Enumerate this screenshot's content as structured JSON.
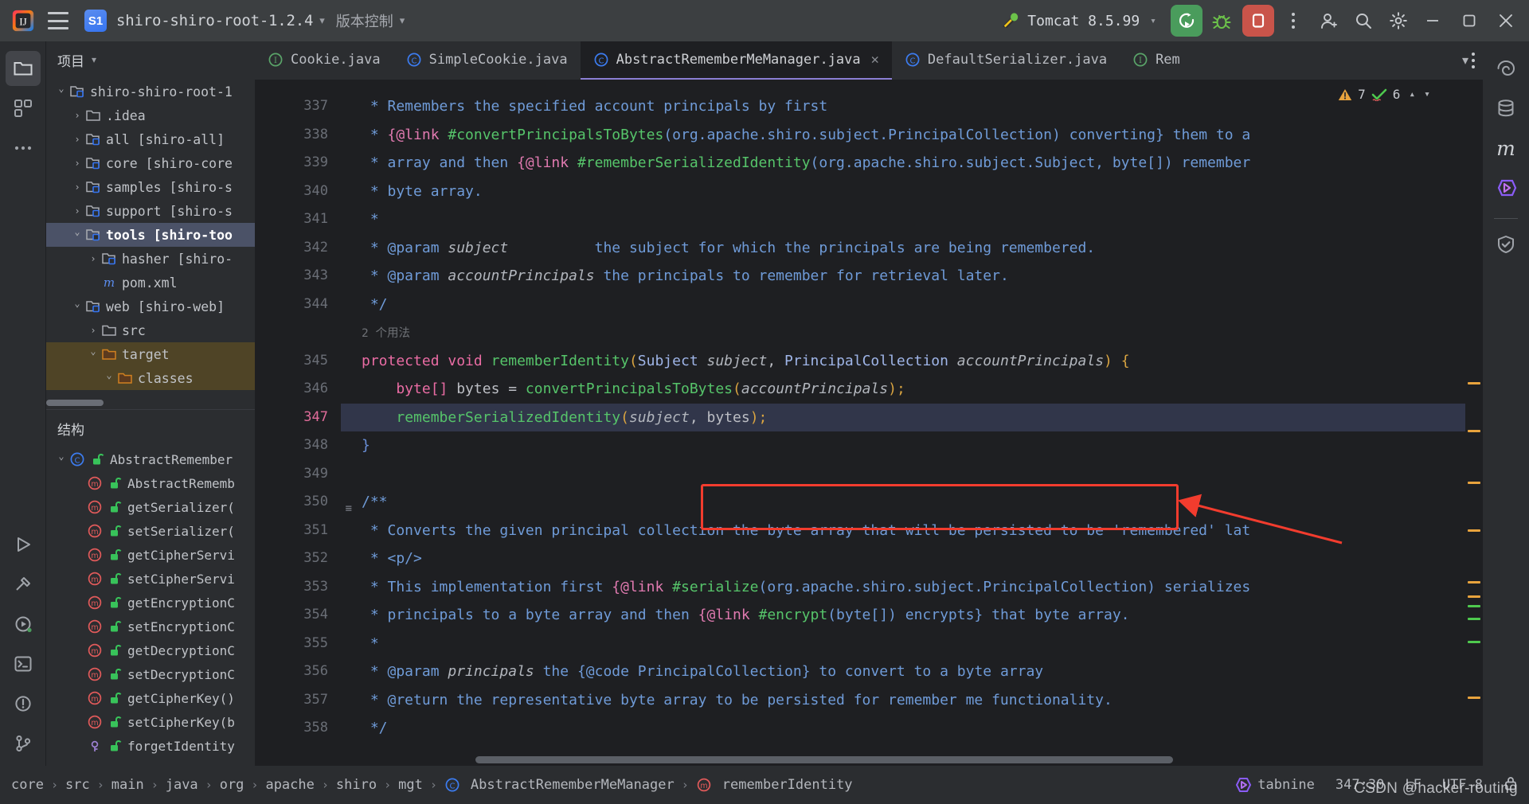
{
  "titlebar": {
    "menu_icon": "hamburger-menu-icon",
    "project_badge": "S1",
    "project_name": "shiro-shiro-root-1.2.4",
    "vcs_label": "版本控制",
    "run_config": "Tomcat 8.5.99",
    "run_button": "run-icon",
    "debug_button": "debug-icon",
    "stop_button": "stop-icon",
    "more_button": "more-vertical-icon",
    "account_button": "account-icon",
    "search_button": "search-icon",
    "settings_button": "settings-icon",
    "minimize": "minimize-icon",
    "maximize": "maximize-icon",
    "close": "close-icon"
  },
  "left_rail": {
    "items": [
      {
        "name": "project-tool-icon",
        "active": true
      },
      {
        "name": "commit-tool-icon",
        "active": false
      },
      {
        "name": "more-tools-icon",
        "active": false
      }
    ],
    "bottom_items": [
      {
        "name": "run-tool-icon"
      },
      {
        "name": "build-tool-icon"
      },
      {
        "name": "services-tool-icon"
      },
      {
        "name": "terminal-tool-icon"
      },
      {
        "name": "problems-tool-icon"
      },
      {
        "name": "version-control-tool-icon"
      }
    ]
  },
  "right_rail": {
    "items": [
      {
        "name": "notifications-icon"
      },
      {
        "name": "database-icon"
      },
      {
        "name": "maven-icon"
      },
      {
        "name": "tabnine-icon"
      },
      {
        "name": "security-icon"
      }
    ]
  },
  "project_panel": {
    "title": "项目",
    "tree": [
      {
        "depth": 0,
        "arrow": "open",
        "icon": "module-folder",
        "label": "shiro-shiro-root-1",
        "selected": false
      },
      {
        "depth": 1,
        "arrow": "closed",
        "icon": "folder",
        "label": ".idea",
        "selected": false
      },
      {
        "depth": 1,
        "arrow": "closed",
        "icon": "module-folder",
        "label": "all [shiro-all]",
        "selected": false
      },
      {
        "depth": 1,
        "arrow": "closed",
        "icon": "module-folder",
        "label": "core [shiro-core",
        "selected": false
      },
      {
        "depth": 1,
        "arrow": "closed",
        "icon": "module-folder",
        "label": "samples [shiro-s",
        "selected": false
      },
      {
        "depth": 1,
        "arrow": "closed",
        "icon": "module-folder",
        "label": "support [shiro-s",
        "selected": false
      },
      {
        "depth": 1,
        "arrow": "open",
        "icon": "module-folder",
        "label": "tools [shiro-too",
        "selected": true
      },
      {
        "depth": 2,
        "arrow": "closed",
        "icon": "module-folder",
        "label": "hasher [shiro-",
        "selected": false
      },
      {
        "depth": 2,
        "arrow": "none",
        "icon": "maven-file",
        "label": "pom.xml",
        "selected": false
      },
      {
        "depth": 1,
        "arrow": "open",
        "icon": "module-folder",
        "label": "web [shiro-web]",
        "selected": false
      },
      {
        "depth": 2,
        "arrow": "closed",
        "icon": "folder",
        "label": "src",
        "selected": false
      },
      {
        "depth": 2,
        "arrow": "open",
        "icon": "folder-orange",
        "label": "target",
        "selected": false,
        "highlight": true
      },
      {
        "depth": 3,
        "arrow": "open",
        "icon": "folder-orange",
        "label": "classes",
        "selected": false,
        "highlight": true
      }
    ]
  },
  "structure_panel": {
    "title": "结构",
    "items": [
      {
        "depth": 0,
        "arrow": "open",
        "icon": "class",
        "label": "AbstractRemember"
      },
      {
        "depth": 1,
        "arrow": "none",
        "icon": "method",
        "label": "AbstractRememb"
      },
      {
        "depth": 1,
        "arrow": "none",
        "icon": "method",
        "label": "getSerializer("
      },
      {
        "depth": 1,
        "arrow": "none",
        "icon": "method",
        "label": "setSerializer("
      },
      {
        "depth": 1,
        "arrow": "none",
        "icon": "method",
        "label": "getCipherServi"
      },
      {
        "depth": 1,
        "arrow": "none",
        "icon": "method",
        "label": "setCipherServi"
      },
      {
        "depth": 1,
        "arrow": "none",
        "icon": "method",
        "label": "getEncryptionC"
      },
      {
        "depth": 1,
        "arrow": "none",
        "icon": "method",
        "label": "setEncryptionC"
      },
      {
        "depth": 1,
        "arrow": "none",
        "icon": "method",
        "label": "getDecryptionC"
      },
      {
        "depth": 1,
        "arrow": "none",
        "icon": "method",
        "label": "setDecryptionC"
      },
      {
        "depth": 1,
        "arrow": "none",
        "icon": "method",
        "label": "getCipherKey()"
      },
      {
        "depth": 1,
        "arrow": "none",
        "icon": "method",
        "label": "setCipherKey(b"
      },
      {
        "depth": 1,
        "arrow": "none",
        "icon": "field",
        "label": "forgetIdentity"
      }
    ]
  },
  "tabs": [
    {
      "label": "Cookie.java",
      "icon": "interface",
      "active": false,
      "closable": false
    },
    {
      "label": "SimpleCookie.java",
      "icon": "class",
      "active": false,
      "closable": false
    },
    {
      "label": "AbstractRememberMeManager.java",
      "icon": "class",
      "active": true,
      "closable": true
    },
    {
      "label": "DefaultSerializer.java",
      "icon": "class",
      "active": false,
      "closable": false
    },
    {
      "label": "Rem",
      "icon": "interface",
      "active": false,
      "closable": false
    }
  ],
  "inspection": {
    "warning_count": "7",
    "ok_count": "6",
    "prev_icon": "chevron-up-icon",
    "next_icon": "chevron-down-icon"
  },
  "editor": {
    "first_line": 337,
    "current_line": 347,
    "inlay_hint": "2 个用法",
    "lines": [
      {
        "n": 337,
        "segments": [
          {
            "t": " * Remembers the specified account principals by first",
            "c": "c-doc"
          }
        ]
      },
      {
        "n": 338,
        "segments": [
          {
            "t": " * ",
            "c": "c-doc"
          },
          {
            "t": "{@link ",
            "c": "c-tag"
          },
          {
            "t": "#convertPrincipalsToBytes",
            "c": "c-ref"
          },
          {
            "t": "(org.apache.shiro.subject.PrincipalCollection) converting}",
            "c": "c-doc"
          },
          {
            "t": " them to a",
            "c": "c-doc"
          }
        ]
      },
      {
        "n": 339,
        "segments": [
          {
            "t": " * array and then ",
            "c": "c-doc"
          },
          {
            "t": "{@link ",
            "c": "c-tag"
          },
          {
            "t": "#rememberSerializedIdentity",
            "c": "c-ref"
          },
          {
            "t": "(org.apache.shiro.subject.Subject, byte[]) remember",
            "c": "c-doc"
          }
        ]
      },
      {
        "n": 340,
        "segments": [
          {
            "t": " * byte array.",
            "c": "c-doc"
          }
        ]
      },
      {
        "n": 341,
        "segments": [
          {
            "t": " *",
            "c": "c-doc"
          }
        ]
      },
      {
        "n": 342,
        "segments": [
          {
            "t": " * @param ",
            "c": "c-doc"
          },
          {
            "t": "subject",
            "c": "c-ital"
          },
          {
            "t": "          the subject for which the principals are being remembered.",
            "c": "c-doc"
          }
        ]
      },
      {
        "n": 343,
        "segments": [
          {
            "t": " * @param ",
            "c": "c-doc"
          },
          {
            "t": "accountPrincipals",
            "c": "c-ital"
          },
          {
            "t": " the principals to remember for retrieval later.",
            "c": "c-doc"
          }
        ]
      },
      {
        "n": 344,
        "segments": [
          {
            "t": " */",
            "c": "c-doc"
          }
        ]
      },
      {
        "n": 345,
        "inlay": "2 个用法",
        "fold": false,
        "segments": [
          {
            "t": "protected void ",
            "c": "c-kw"
          },
          {
            "t": "rememberIdentity",
            "c": "c-meth"
          },
          {
            "t": "(",
            "c": "c-par"
          },
          {
            "t": "Subject ",
            "c": "c-type"
          },
          {
            "t": "subject",
            "c": "c-ital"
          },
          {
            "t": ", ",
            "c": "c-txt"
          },
          {
            "t": "PrincipalCollection ",
            "c": "c-type"
          },
          {
            "t": "accountPrincipals",
            "c": "c-ital"
          },
          {
            "t": ") {",
            "c": "c-par"
          }
        ]
      },
      {
        "n": 346,
        "segments": [
          {
            "t": "    byte[] ",
            "c": "c-kw"
          },
          {
            "t": "bytes = ",
            "c": "c-txt"
          },
          {
            "t": "convertPrincipalsToBytes",
            "c": "c-meth"
          },
          {
            "t": "(",
            "c": "c-par"
          },
          {
            "t": "accountPrincipals",
            "c": "c-ital"
          },
          {
            "t": ")",
            "c": "c-par"
          },
          {
            "t": ";",
            "c": "c-par"
          }
        ]
      },
      {
        "n": 347,
        "highlight": true,
        "segments": [
          {
            "t": "    ",
            "c": "c-txt"
          },
          {
            "t": "rememberSerializedIdentity",
            "c": "c-meth"
          },
          {
            "t": "(",
            "c": "c-par"
          },
          {
            "t": "subject",
            "c": "c-ital"
          },
          {
            "t": ", ",
            "c": "c-txt"
          },
          {
            "t": "bytes",
            "c": "c-txt"
          },
          {
            "t": ")",
            "c": "c-par"
          },
          {
            "t": ";",
            "c": "c-par"
          }
        ]
      },
      {
        "n": 348,
        "segments": [
          {
            "t": "}",
            "c": "c-brace"
          }
        ]
      },
      {
        "n": 349,
        "segments": [
          {
            "t": "",
            "c": "c-txt"
          }
        ]
      },
      {
        "n": 350,
        "fold": true,
        "segments": [
          {
            "t": "/**",
            "c": "c-doc"
          }
        ]
      },
      {
        "n": 351,
        "segments": [
          {
            "t": " * Converts the given principal collection the byte array that will be persisted to be 'remembered' lat",
            "c": "c-doc"
          }
        ]
      },
      {
        "n": 352,
        "segments": [
          {
            "t": " * <p/>",
            "c": "c-doc"
          }
        ]
      },
      {
        "n": 353,
        "segments": [
          {
            "t": " * This implementation first ",
            "c": "c-doc"
          },
          {
            "t": "{@link ",
            "c": "c-tag"
          },
          {
            "t": "#serialize",
            "c": "c-ref"
          },
          {
            "t": "(org.apache.shiro.subject.PrincipalCollection) serializes",
            "c": "c-doc"
          }
        ]
      },
      {
        "n": 354,
        "segments": [
          {
            "t": " * principals to a byte array and then ",
            "c": "c-doc"
          },
          {
            "t": "{@link ",
            "c": "c-tag"
          },
          {
            "t": "#encrypt",
            "c": "c-ref"
          },
          {
            "t": "(byte[]) encrypts}",
            "c": "c-doc"
          },
          {
            "t": " that byte array.",
            "c": "c-doc"
          }
        ]
      },
      {
        "n": 355,
        "segments": [
          {
            "t": " *",
            "c": "c-doc"
          }
        ]
      },
      {
        "n": 356,
        "segments": [
          {
            "t": " * @param ",
            "c": "c-doc"
          },
          {
            "t": "principals",
            "c": "c-ital"
          },
          {
            "t": " the ",
            "c": "c-doc"
          },
          {
            "t": "{@code PrincipalCollection}",
            "c": "c-doc"
          },
          {
            "t": " to convert to a byte array",
            "c": "c-doc"
          }
        ]
      },
      {
        "n": 357,
        "segments": [
          {
            "t": " * @return the representative byte array to be persisted for remember me functionality.",
            "c": "c-doc"
          }
        ]
      },
      {
        "n": 358,
        "segments": [
          {
            "t": " */",
            "c": "c-doc"
          }
        ]
      }
    ]
  },
  "statusbar": {
    "breadcrumbs": [
      "core",
      "src",
      "main",
      "java",
      "org",
      "apache",
      "shiro",
      "mgt",
      "AbstractRememberMeManager",
      "rememberIdentity"
    ],
    "tabnine_label": "tabnine",
    "caret_position": "347:30",
    "line_separator": "LF",
    "encoding": "UTF-8",
    "watermark": "CSDN @hacker-routing"
  },
  "colors": {
    "accent_blue": "#3574f0",
    "run_green": "#4a9c5c",
    "stop_red": "#c9544a",
    "annotation_red": "#f23c2e",
    "warning_orange": "#e8a33d",
    "bg_editor": "#1e1f22",
    "bg_panel": "#2b2d30"
  }
}
